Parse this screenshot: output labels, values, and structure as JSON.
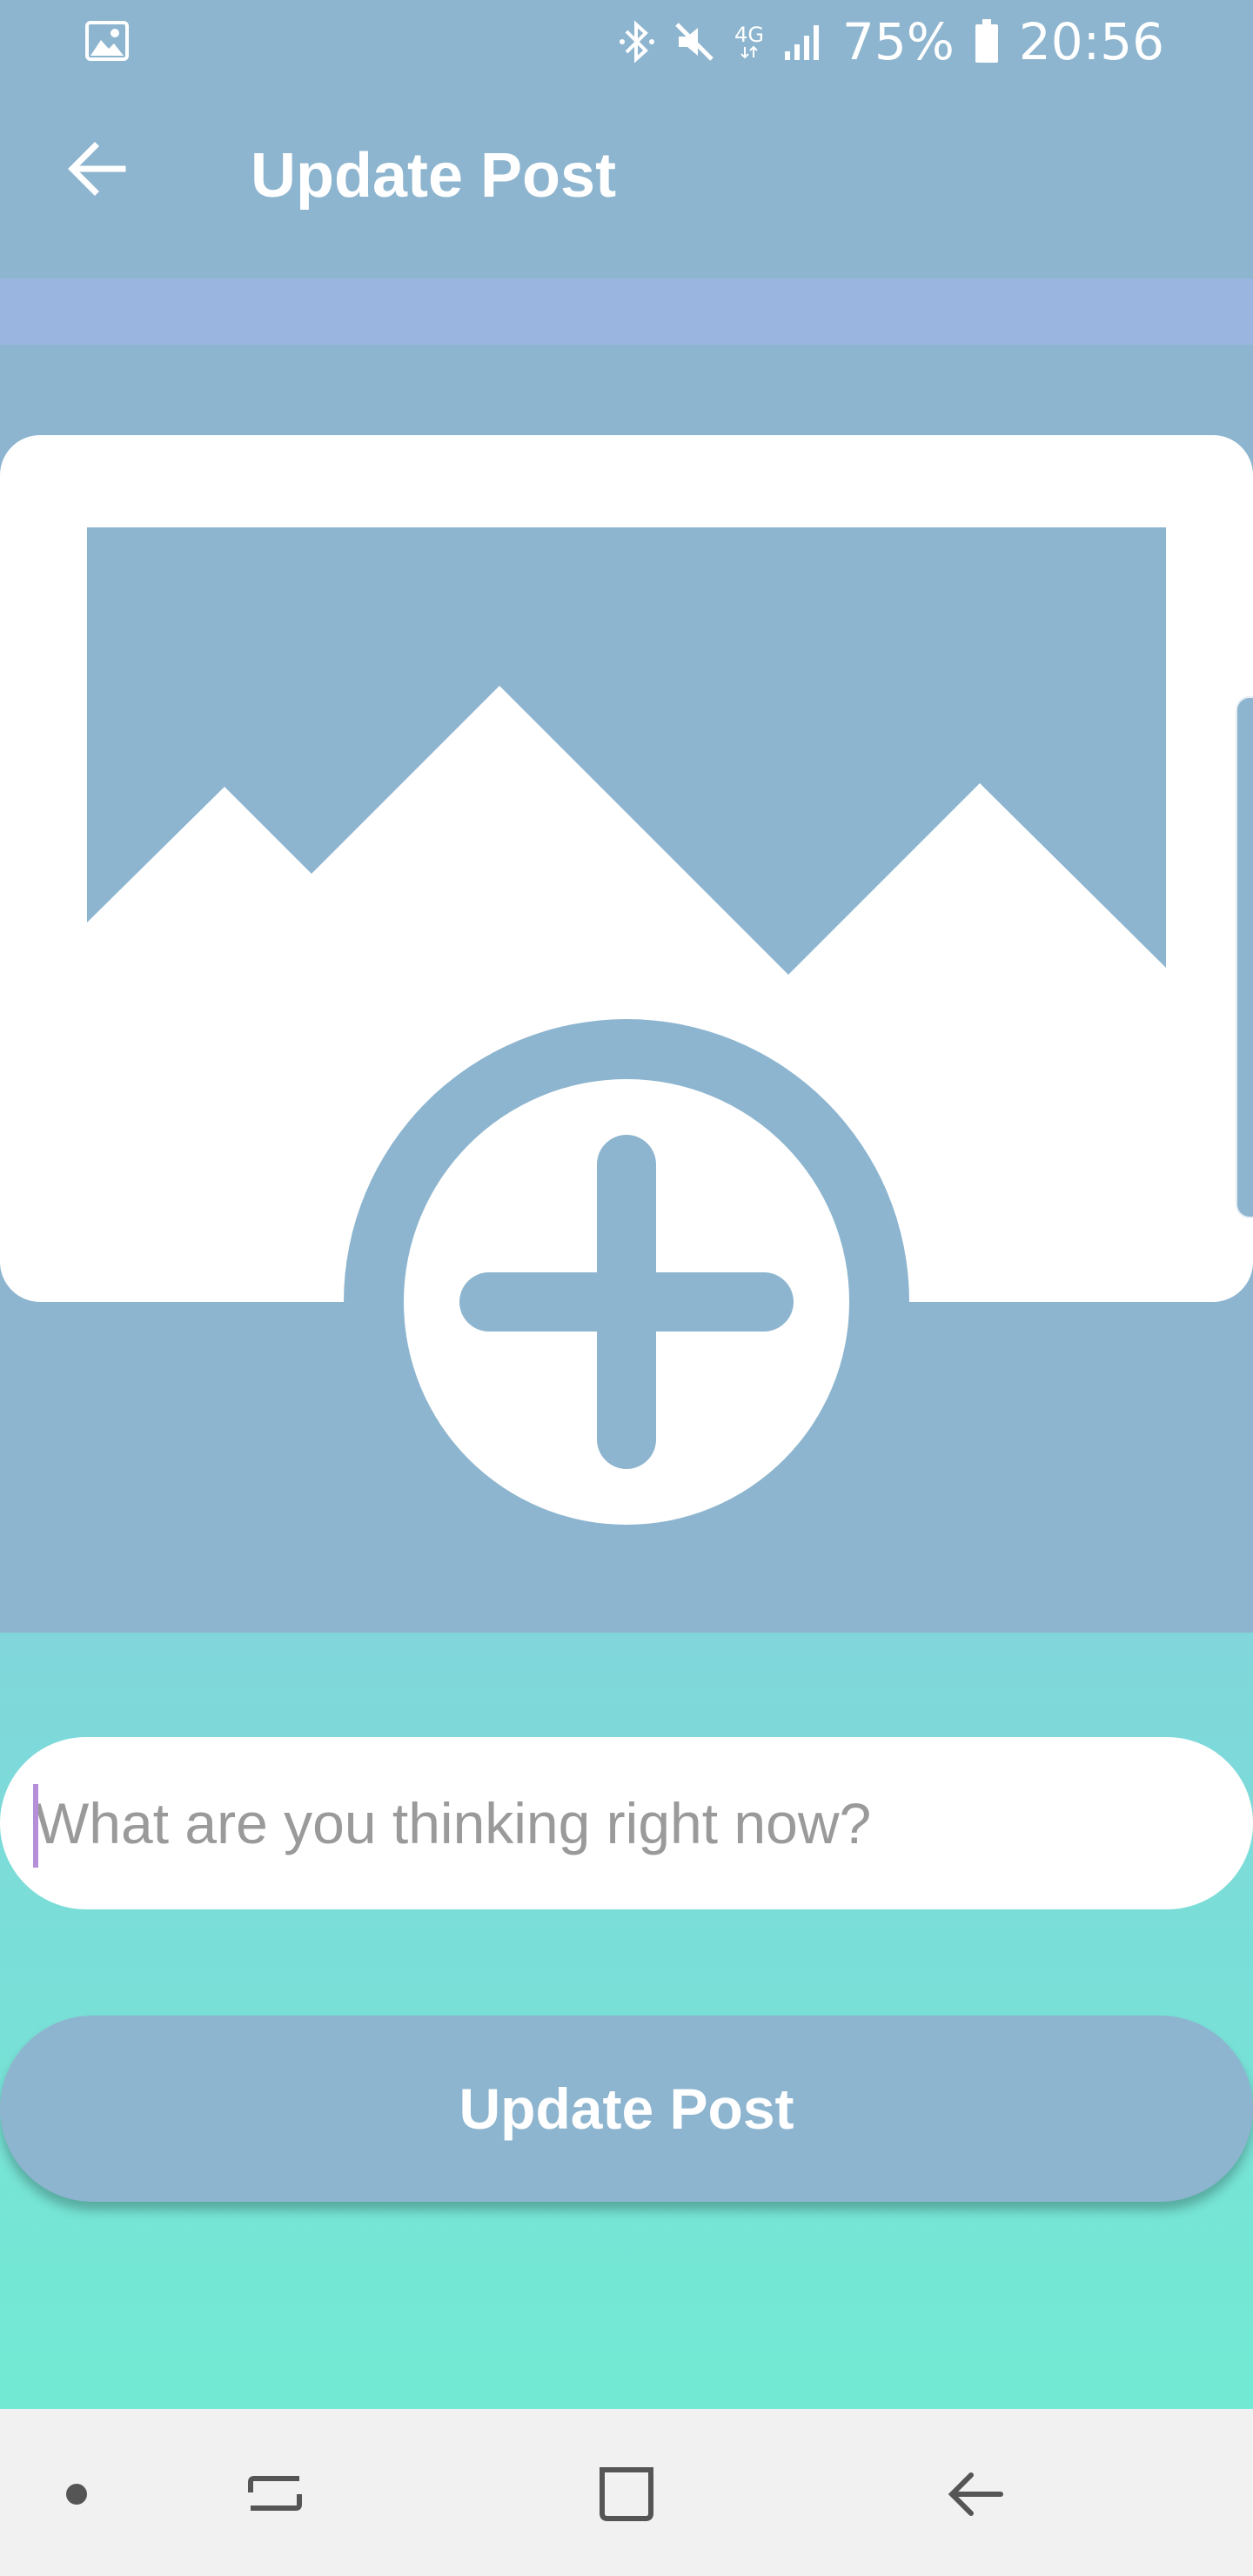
{
  "status_bar": {
    "battery_text": "75%",
    "time": "20:56",
    "network_label": "4G",
    "icons": [
      "image-notification-icon",
      "bluetooth-icon",
      "mute-icon",
      "4g-icon",
      "signal-icon",
      "battery-icon"
    ]
  },
  "app_bar": {
    "title": "Update Post",
    "back_icon": "arrow-back-icon"
  },
  "image_picker": {
    "icon": "add-photo-icon"
  },
  "form": {
    "input_placeholder": "What are you thinking right now?",
    "submit_label": "Update Post"
  },
  "nav_bar": {
    "icons": [
      "dot-icon",
      "recent-apps-icon",
      "home-icon",
      "back-icon"
    ]
  },
  "colors": {
    "primary": "#8DB5CF",
    "accent_strip": "#9AB5E0",
    "gradient_top": "#80D6DB",
    "gradient_bottom": "#72EAD3",
    "cursor": "#B58FD7"
  }
}
